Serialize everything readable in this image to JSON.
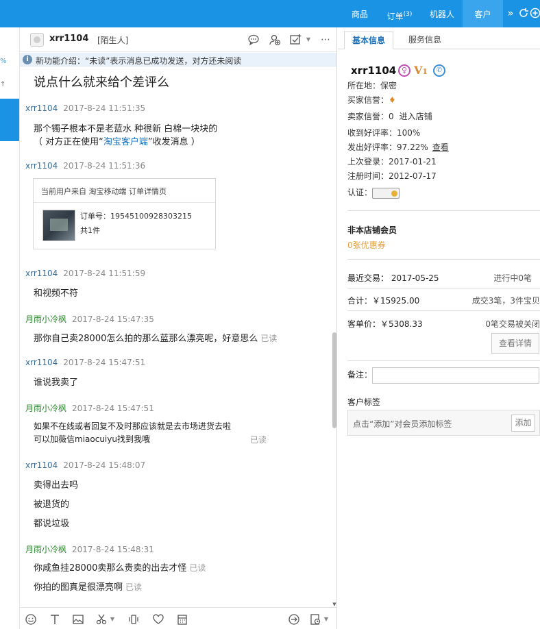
{
  "topbar": {
    "tabs": [
      {
        "label": "商品"
      },
      {
        "label": "订单",
        "badge": "(3)"
      },
      {
        "label": "机器人"
      },
      {
        "label": "客户"
      }
    ],
    "more_glyph": "»"
  },
  "left": {
    "glyph1": "%",
    "glyph2": "↑↓"
  },
  "chat": {
    "contact_name": "xrr1104",
    "contact_tag": "[陌生人]",
    "notice": "新功能介绍：“未读”表示消息已成功发送，对方还未阅读",
    "partial_top": "说点什么就来给个差评么",
    "read_label": "已读",
    "messages": [
      {
        "who": "xrr1104",
        "time": "2017-8-24 11:51:35",
        "lines": [
          "那个镯子根本不是老蓝水 种很新 白棉一块块的"
        ],
        "client_pre": "（ 对方正在使用“",
        "client_link": "淘宝客户端",
        "client_post": "”收发消息 ）"
      },
      {
        "who": "xrr1104",
        "time": "2017-8-24 11:51:36"
      },
      {
        "who": "xrr1104",
        "time": "2017-8-24 11:51:59",
        "lines": [
          "和视频不符"
        ]
      },
      {
        "who": "月雨小冷枫",
        "time": "2017-8-24 15:47:35",
        "lines": [
          "那你自己卖28000怎么拍的那么蓝那么漂亮呢，好意思么"
        ]
      },
      {
        "who": "xrr1104",
        "time": "2017-8-24 15:47:51",
        "lines": [
          "谁说我卖了"
        ]
      },
      {
        "who": "月雨小冷枫",
        "time": "2017-8-24 15:47:51",
        "lines": [
          "如果不在线或者回复不及时那应该就是去市场进货去啦",
          "可以加薇信miaocuiyu找到我哦"
        ]
      },
      {
        "who": "xrr1104",
        "time": "2017-8-24 15:48:07",
        "lines": [
          "卖得出去吗",
          "被退货的",
          "都说垃圾"
        ]
      },
      {
        "who": "月雨小冷枫",
        "time": "2017-8-24 15:48:31",
        "lines": [
          "你咸鱼挂28000卖那么贵卖的出去才怪",
          "你拍的图真是很漂亮啊"
        ]
      }
    ],
    "order_card": {
      "source": "当前用户来自 淘宝移动端 订单详情页",
      "order_no": "订单号：19545100928303215",
      "count": "共1件"
    }
  },
  "right": {
    "tabs": [
      {
        "label": "基本信息"
      },
      {
        "label": "服务信息"
      }
    ],
    "customer_name": "xrr1104",
    "gender_symbol": "♀",
    "vip_letter": "V",
    "vip_level": "1",
    "location": "所在地：保密",
    "buyer_credit_label": "买家信誉：",
    "seller_credit": "卖家信誉：0",
    "enter_shop": "进入店铺",
    "received_good_rate": "收到好评率：100%",
    "given_good_rate": "发出好评率：97.22%",
    "view_link": "查看",
    "last_login": "上次登录：2017-01-21",
    "register_time": "注册时间：2012-07-17",
    "verified_label": "认证：",
    "member_status": "非本店铺会员",
    "coupons": "0张优惠券",
    "recent_trade": "最近交易： 2017-05-25",
    "in_progress": "进行中0笔",
    "total": "合计：￥15925.00",
    "deals": "成交3笔，3件宝贝",
    "unit_price": "客单价：￥5308.33",
    "closed_deals": "0笔交易被关闭",
    "detail_button": "查看详情",
    "note_label": "备注：",
    "tags_label": "客户标签",
    "tags_hint": "点击“添加”对会员添加标签",
    "add_button": "添加"
  },
  "colors": {
    "brand_blue": "#1a93e4",
    "link_blue": "#1b72c0",
    "contact_name": "#2f6ea5",
    "self_name": "#2a8a2a",
    "coupon_orange": "#e2a040"
  },
  "icons": [
    "chevron-double-right-icon",
    "refresh-icon",
    "add-circle-icon",
    "chat-bubble-icon",
    "add-contact-icon",
    "add-task-icon",
    "more-icon",
    "info-icon",
    "emoji-icon",
    "font-icon",
    "image-icon",
    "scissors-icon",
    "shake-icon",
    "heart-icon",
    "calendar-icon",
    "quick-reply-icon",
    "history-icon",
    "diamond-icon"
  ]
}
